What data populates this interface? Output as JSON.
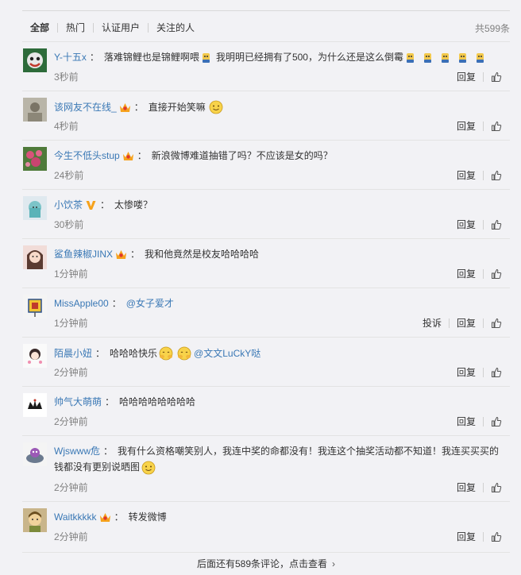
{
  "tabs": [
    {
      "label": "全部"
    },
    {
      "label": "热门"
    },
    {
      "label": "认证用户"
    },
    {
      "label": "关注的人"
    }
  ],
  "total": "共599条",
  "actions": {
    "reply": "回复",
    "report": "投诉"
  },
  "comments": [
    {
      "user": "Y-十五x",
      "text": "落难锦鲤也是锦鲤啊喂",
      "text2": "我明明已经拥有了500，为什么还是这么倒霉",
      "time": "3秒前"
    },
    {
      "user": "该网友不在线_",
      "text": "直接开始笑嘛",
      "time": "4秒前"
    },
    {
      "user": "今生不低头stup",
      "text": "新浪微博难道抽错了吗？不应该是女的吗？",
      "time": "24秒前"
    },
    {
      "user": "小饮茶",
      "text": "太惨喽？",
      "time": "30秒前"
    },
    {
      "user": "鲨鱼辣椒JINX",
      "text": "我和他竟然是校友哈哈哈哈",
      "time": "1分钟前"
    },
    {
      "user": "MissApple00",
      "text": "@女子爱才",
      "time": "1分钟前"
    },
    {
      "user": "陌晨小妞",
      "text": "哈哈哈快乐",
      "mention": "@文文LuCkY哒",
      "time": "2分钟前"
    },
    {
      "user": "帅气大萌萌",
      "text": "哈哈哈哈哈哈哈哈",
      "time": "2分钟前"
    },
    {
      "user": "Wjswww危",
      "text": "我有什么资格嘲笑别人，我连中奖的命都没有！我连这个抽奖活动都不知道！我连买买买的钱都没有更别说晒图",
      "time": "2分钟前"
    },
    {
      "user": "Waitkkkkk",
      "text": "转发微博",
      "time": "2分钟前"
    }
  ],
  "more": {
    "label": "后面还有589条评论，点击查看"
  }
}
